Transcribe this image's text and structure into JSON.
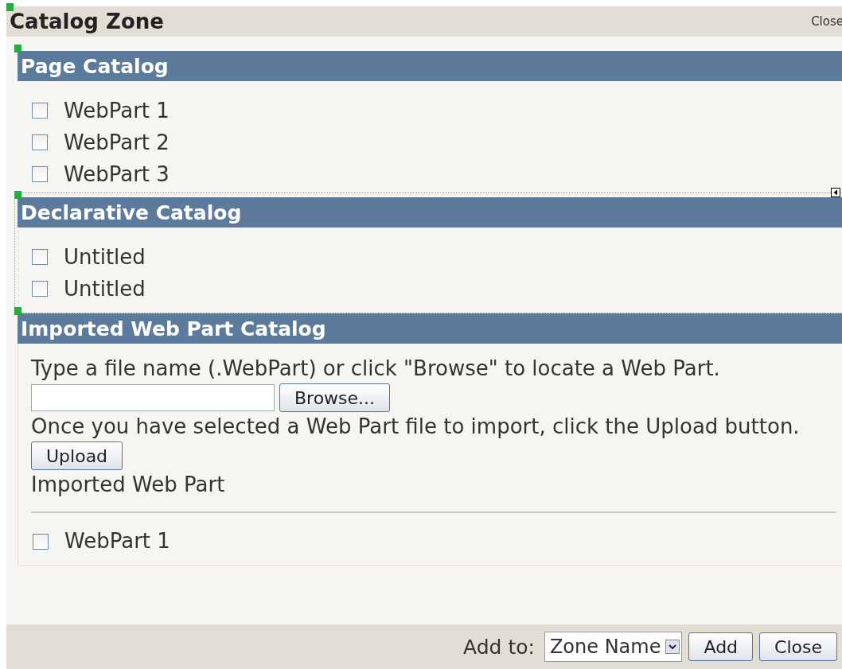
{
  "zone": {
    "title": "Catalog Zone",
    "close_link": "Close"
  },
  "catalogs": [
    {
      "kind": "checklist",
      "title": "Page Catalog",
      "dotted": false,
      "items": [
        {
          "label": "WebPart 1",
          "checked": false
        },
        {
          "label": "WebPart 2",
          "checked": false
        },
        {
          "label": "WebPart 3",
          "checked": false
        }
      ]
    },
    {
      "kind": "checklist",
      "title": "Declarative Catalog",
      "dotted": true,
      "items": [
        {
          "label": "Untitled",
          "checked": false
        },
        {
          "label": "Untitled",
          "checked": false
        }
      ]
    },
    {
      "kind": "import",
      "title": "Imported Web Part Catalog",
      "instruction": "Type a file name (.WebPart) or click \"Browse\" to locate a Web Part.",
      "browse_button": "Browse...",
      "upload_instruction": "Once you have selected a Web Part file to import, click the Upload button.",
      "upload_button": "Upload",
      "imported_label": "Imported Web Part",
      "items": [
        {
          "label": "WebPart 1",
          "checked": false
        }
      ]
    }
  ],
  "footer": {
    "add_to_label": "Add to:",
    "zone_select": "Zone Name",
    "add_button": "Add",
    "close_button": "Close"
  }
}
